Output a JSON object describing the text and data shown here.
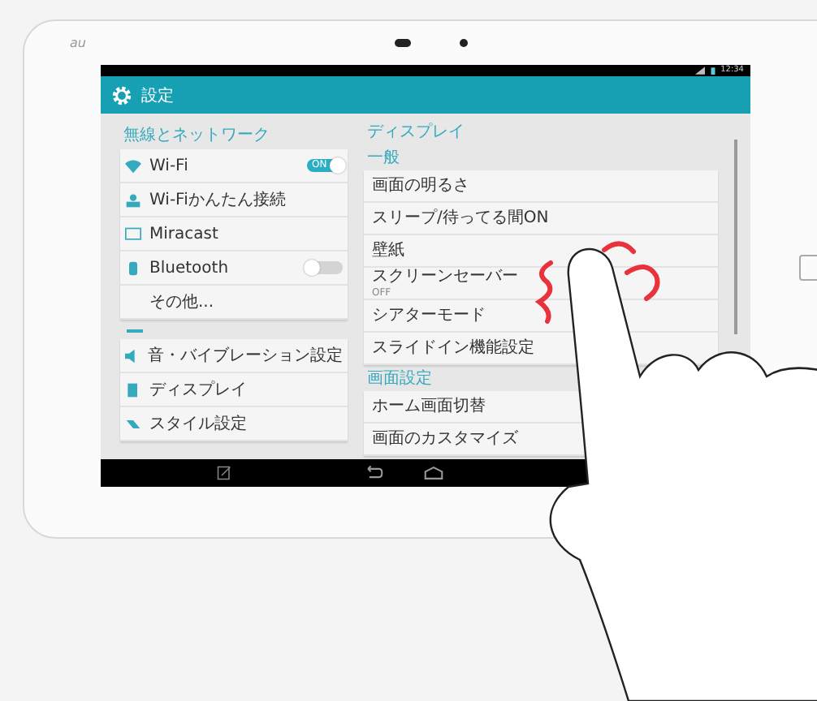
{
  "device": {
    "brand": "au"
  },
  "status_bar": {
    "time": "12:34"
  },
  "action_bar": {
    "title": "設定"
  },
  "left_sections": [
    {
      "header": "無線とネットワーク",
      "items": [
        {
          "kind": "toggle",
          "label": "Wi-Fi",
          "on": true,
          "toggle_text": "ON"
        },
        {
          "kind": "plain",
          "label": "Wi-Fiかんたん接続"
        },
        {
          "kind": "plain",
          "label": "Miracast"
        },
        {
          "kind": "toggle",
          "label": "Bluetooth",
          "on": false
        },
        {
          "kind": "plain",
          "label": "その他..."
        }
      ]
    },
    {
      "items": [
        {
          "kind": "plain",
          "label": "音・バイブレーション設定"
        },
        {
          "kind": "plain",
          "label": "ディスプレイ"
        },
        {
          "kind": "plain",
          "label": "スタイル設定"
        }
      ]
    }
  ],
  "detail": {
    "title": "ディスプレイ",
    "sections": [
      {
        "header": "一般",
        "items": [
          {
            "title": "画面の明るさ"
          },
          {
            "title": "スリープ/待ってる間ON"
          },
          {
            "title": "壁紙"
          },
          {
            "title": "スクリーンセーバー",
            "summary": "OFF"
          },
          {
            "title": "シアターモード"
          },
          {
            "title": "スライドイン機能設定"
          }
        ]
      },
      {
        "header": "画面設定",
        "items": [
          {
            "title": "ホーム画面切替"
          },
          {
            "title": "画面のカスタマイズ"
          }
        ]
      }
    ]
  }
}
